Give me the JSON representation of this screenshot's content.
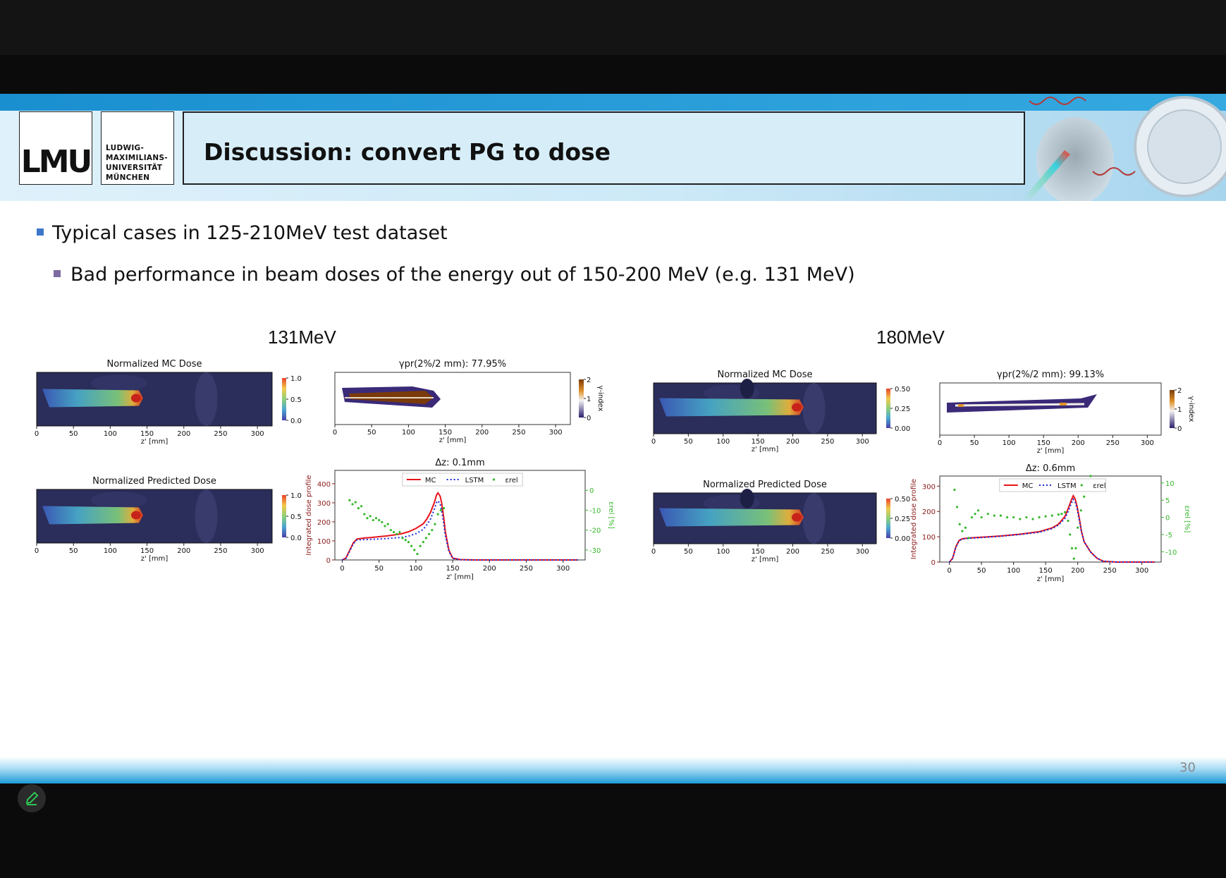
{
  "header": {
    "logo": "LMU",
    "univ_lines": [
      "LUDWIG-",
      "MAXIMILIANS-",
      "UNIVERSITÄT",
      "MÜNCHEN"
    ],
    "title": "Discussion: convert PG to dose"
  },
  "bullets": {
    "level1": "Typical cases in 125-210MeV test dataset",
    "level2": "Bad performance in beam doses of the energy out of 150-200 MeV (e.g. 131 MeV)"
  },
  "panels": [
    {
      "energy": "131MeV",
      "mc_title": "Normalized MC Dose",
      "pred_title": "Normalized Predicted Dose",
      "gamma_title": "γpr(2%/2 mm): 77.95%",
      "profile_title": "Δz: 0.1mm",
      "dose_ticks": [
        "1.0",
        "0.5",
        "0.0"
      ]
    },
    {
      "energy": "180MeV",
      "mc_title": "Normalized MC Dose",
      "pred_title": "Normalized Predicted Dose",
      "gamma_title": "γpr(2%/2 mm): 99.13%",
      "profile_title": "Δz: 0.6mm",
      "dose_ticks": [
        "0.50",
        "0.25",
        "0.00"
      ]
    }
  ],
  "labels": {
    "zaxis": "z' [mm]",
    "gamma_cbar": "γ-index",
    "profile_ylabel": "Integrated dose profile",
    "erel_ylabel": "εrel [%]",
    "legend": [
      "MC",
      "LSTM",
      "εrel"
    ]
  },
  "chart_data": [
    {
      "type": "line",
      "title": "Δz: 0.1mm",
      "xlabel": "z' [mm]",
      "ylabel": "Integrated dose profile",
      "y2label": "εrel [%]",
      "xlim": [
        -10,
        330
      ],
      "ylim": [
        0,
        470
      ],
      "y2lim": [
        -35,
        10
      ],
      "xticks": [
        0,
        50,
        100,
        150,
        200,
        250,
        300
      ],
      "yticks": [
        0,
        100,
        200,
        300,
        400
      ],
      "y2ticks": [
        0,
        -10,
        -20,
        -30
      ],
      "legend": "top-center",
      "series": [
        {
          "name": "MC",
          "color": "#e8141b",
          "style": "solid",
          "x": [
            0,
            5,
            10,
            15,
            20,
            30,
            40,
            50,
            60,
            70,
            80,
            90,
            100,
            110,
            115,
            120,
            125,
            128,
            130,
            133,
            135,
            138,
            140,
            145,
            150,
            160,
            180,
            220,
            260,
            300,
            320
          ],
          "y": [
            0,
            10,
            50,
            90,
            110,
            115,
            118,
            122,
            126,
            131,
            137,
            148,
            165,
            190,
            215,
            250,
            300,
            340,
            352,
            335,
            300,
            220,
            150,
            50,
            10,
            2,
            0,
            0,
            0,
            0,
            0
          ]
        },
        {
          "name": "LSTM",
          "color": "#1a2ad8",
          "style": "dotted",
          "x": [
            0,
            5,
            10,
            15,
            20,
            30,
            40,
            50,
            60,
            70,
            80,
            90,
            100,
            110,
            115,
            120,
            125,
            128,
            130,
            133,
            135,
            138,
            140,
            145,
            150,
            160,
            180,
            220,
            260,
            300,
            320
          ],
          "y": [
            0,
            8,
            45,
            85,
            105,
            107,
            108,
            110,
            112,
            115,
            118,
            125,
            138,
            160,
            185,
            215,
            265,
            300,
            310,
            295,
            260,
            190,
            130,
            45,
            8,
            1,
            0,
            0,
            0,
            0,
            0
          ]
        },
        {
          "name": "εrel",
          "color": "#35b82a",
          "style": "points",
          "axis": "right",
          "x": [
            10,
            14,
            18,
            22,
            26,
            30,
            34,
            38,
            42,
            46,
            50,
            54,
            58,
            62,
            66,
            70,
            74,
            78,
            82,
            86,
            90,
            94,
            98,
            102,
            106,
            110,
            114,
            118,
            122,
            126,
            130,
            134,
            138
          ],
          "y": [
            -5,
            -7,
            -6,
            -9,
            -8,
            -12,
            -14,
            -13,
            -15,
            -14,
            -15,
            -16,
            -18,
            -17,
            -20,
            -21,
            -22,
            -21,
            -24,
            -25,
            -26,
            -28,
            -30,
            -32,
            -28,
            -26,
            -24,
            -22,
            -20,
            -17,
            -12,
            -10,
            -9
          ]
        }
      ]
    },
    {
      "type": "line",
      "title": "Δz: 0.6mm",
      "xlabel": "z' [mm]",
      "ylabel": "Integrated dose profile",
      "y2label": "εrel [%]",
      "xlim": [
        -15,
        330
      ],
      "ylim": [
        0,
        340
      ],
      "y2lim": [
        -13,
        12
      ],
      "xticks": [
        0,
        50,
        100,
        150,
        200,
        250,
        300
      ],
      "yticks": [
        0,
        100,
        200,
        300
      ],
      "y2ticks": [
        10,
        5,
        0,
        -5,
        -10
      ],
      "legend": "top-center",
      "series": [
        {
          "name": "MC",
          "color": "#e8141b",
          "style": "solid",
          "x": [
            0,
            5,
            10,
            15,
            20,
            30,
            50,
            80,
            110,
            140,
            160,
            170,
            180,
            185,
            190,
            193,
            196,
            199,
            202,
            206,
            210,
            220,
            230,
            240,
            260,
            300,
            320
          ],
          "y": [
            0,
            15,
            60,
            85,
            92,
            95,
            98,
            103,
            110,
            120,
            135,
            150,
            180,
            210,
            245,
            262,
            250,
            220,
            180,
            120,
            80,
            40,
            15,
            3,
            0,
            0,
            0
          ]
        },
        {
          "name": "LSTM",
          "color": "#1a2ad8",
          "style": "dotted",
          "x": [
            0,
            5,
            10,
            15,
            20,
            30,
            50,
            80,
            110,
            140,
            160,
            170,
            180,
            185,
            190,
            193,
            196,
            199,
            202,
            206,
            210,
            220,
            230,
            240,
            260,
            300,
            320
          ],
          "y": [
            0,
            14,
            58,
            84,
            91,
            94,
            97,
            102,
            109,
            118,
            132,
            146,
            172,
            200,
            232,
            248,
            238,
            210,
            172,
            118,
            80,
            40,
            15,
            3,
            0,
            0,
            0
          ]
        },
        {
          "name": "εrel",
          "color": "#35b82a",
          "style": "points",
          "axis": "right",
          "x": [
            8,
            12,
            16,
            20,
            25,
            30,
            35,
            40,
            45,
            50,
            60,
            70,
            80,
            90,
            100,
            110,
            120,
            130,
            140,
            150,
            160,
            170,
            175,
            180,
            185,
            188,
            191,
            194,
            197,
            200,
            205,
            210,
            215,
            220
          ],
          "y": [
            8,
            3,
            -2,
            -4,
            -3,
            -6,
            0,
            1,
            2,
            0,
            1,
            0.5,
            0.5,
            0,
            0,
            -0.5,
            0,
            -0.5,
            0,
            0.3,
            0.5,
            0.8,
            1,
            1.5,
            -1,
            -5,
            -9,
            -12,
            -9,
            -3,
            2,
            6,
            10,
            12
          ]
        }
      ]
    }
  ],
  "slide": {
    "page": "30"
  }
}
